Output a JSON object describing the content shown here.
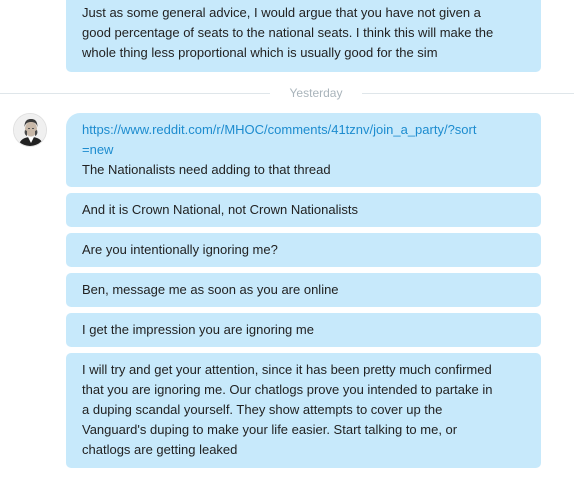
{
  "conversation": {
    "earlier": {
      "message": "Just as some general advice, I would argue that you have not given a\ngood percentage of seats to the national seats. I think this will make the\nwhole thing less proportional which is usually good for the sim"
    },
    "divider_label": "Yesterday",
    "messages": [
      {
        "link": "https://www.reddit.com/r/MHOC/comments/41tznv/join_a_party/?sort\n=new",
        "text": "The Nationalists need adding to that thread"
      },
      {
        "text": "And it is Crown National, not Crown Nationalists"
      },
      {
        "text": "Are you intentionally ignoring me?"
      },
      {
        "text": "Ben, message me as soon as you are online"
      },
      {
        "text": "I get the impression you are ignoring me"
      },
      {
        "text": "I will try and get your attention, since it has been pretty much confirmed\nthat you are ignoring me. Our chatlogs prove you intended to partake in\na duping scandal yourself. They show attempts to cover up the\nVanguard's duping to make your life easier. Start talking to me, or\nchatlogs are getting leaked"
      }
    ]
  },
  "colors": {
    "bubble": "#c7e9fb",
    "link": "#1d8ccf",
    "divider_text": "#a9b4bb"
  },
  "icons": {
    "avatar": "user-avatar-portrait"
  }
}
